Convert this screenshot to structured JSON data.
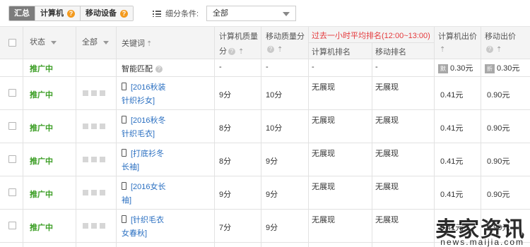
{
  "tabs": [
    {
      "label": "汇总",
      "active": true,
      "help": false
    },
    {
      "label": "计算机",
      "active": false,
      "help": true
    },
    {
      "label": "移动设备",
      "active": false,
      "help": true
    }
  ],
  "filter": {
    "label": "细分条件:",
    "value": "全部"
  },
  "headers": {
    "status": "状态",
    "all": "全部",
    "keyword": "关键词",
    "pc_quality_1": "计算机质量",
    "pc_quality_2": "分",
    "mobile_quality_1": "移动质量分",
    "avg_rank": "过去一小时平均排名(12:00~13:00)",
    "pc_rank": "计算机排名",
    "mobile_rank": "移动排名",
    "pc_bid": "计算机出价",
    "mobile_bid": "移动出价"
  },
  "smart_row": {
    "status": "推广中",
    "keyword": "智能匹配",
    "pc_quality": "-",
    "mobile_quality": "-",
    "pc_rank": "-",
    "mobile_rank": "-",
    "pc_badge": "默",
    "pc_bid": "0.30元",
    "mobile_badge": "折",
    "mobile_bid": "0.30元"
  },
  "rows": [
    {
      "status": "推广中",
      "kw_line1": "[2016秋装",
      "kw_line2": "针织衫女]",
      "pc_quality": "9分",
      "mobile_quality": "10分",
      "pc_rank": "无展现",
      "mobile_rank": "无展现",
      "pc_bid": "0.41元",
      "mobile_bid": "0.90元"
    },
    {
      "status": "推广中",
      "kw_line1": "[2016秋冬",
      "kw_line2": "针织毛衣]",
      "pc_quality": "8分",
      "mobile_quality": "10分",
      "pc_rank": "无展现",
      "mobile_rank": "无展现",
      "pc_bid": "0.41元",
      "mobile_bid": "0.90元"
    },
    {
      "status": "推广中",
      "kw_line1": "[打底衫冬",
      "kw_line2": "长袖]",
      "pc_quality": "8分",
      "mobile_quality": "9分",
      "pc_rank": "无展现",
      "mobile_rank": "无展现",
      "pc_bid": "0.41元",
      "mobile_bid": "0.90元"
    },
    {
      "status": "推广中",
      "kw_line1": "[2016女长",
      "kw_line2": "袖]",
      "pc_quality": "9分",
      "mobile_quality": "9分",
      "pc_rank": "无展现",
      "mobile_rank": "无展现",
      "pc_bid": "0.41元",
      "mobile_bid": "0.90元"
    },
    {
      "status": "推广中",
      "kw_line1": "[针织毛衣",
      "kw_line2": "女春秋]",
      "pc_quality": "7分",
      "mobile_quality": "9分",
      "pc_rank": "无展现",
      "mobile_rank": "无展现",
      "pc_bid": "0.41元",
      "mobile_bid": "0.90元"
    }
  ],
  "watermark": {
    "title": "卖家资讯",
    "url": "news.maijia.com"
  },
  "colors": {
    "status_green": "#3a9d23",
    "link_blue": "#2a6fc1",
    "accent_red": "#e4393c",
    "help_orange": "#f39a1e"
  }
}
